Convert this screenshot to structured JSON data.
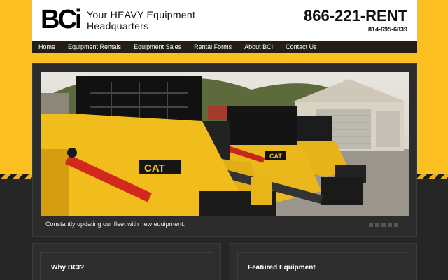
{
  "header": {
    "logo_text": "BCi",
    "tagline_line1": "Your HEAVY Equipment",
    "tagline_line2": "Headquarters",
    "phone_primary": "866-221-RENT",
    "phone_secondary": "814-695-6839"
  },
  "nav": {
    "items": [
      {
        "label": "Home"
      },
      {
        "label": "Equipment Rentals"
      },
      {
        "label": "Equipment Sales"
      },
      {
        "label": "Rental Forms"
      },
      {
        "label": "About BCI"
      },
      {
        "label": "Contact Us"
      }
    ]
  },
  "slider": {
    "caption": "Constantly updating our fleet with new equipment.",
    "slide_count": 5,
    "image_brand": "CAT"
  },
  "panels": {
    "why": {
      "title": "Why BCI?"
    },
    "featured": {
      "title": "Featured Equipment"
    }
  },
  "colors": {
    "brand_yellow": "#fcc020",
    "nav_dark": "#231f18",
    "footer_dark": "#262626"
  }
}
